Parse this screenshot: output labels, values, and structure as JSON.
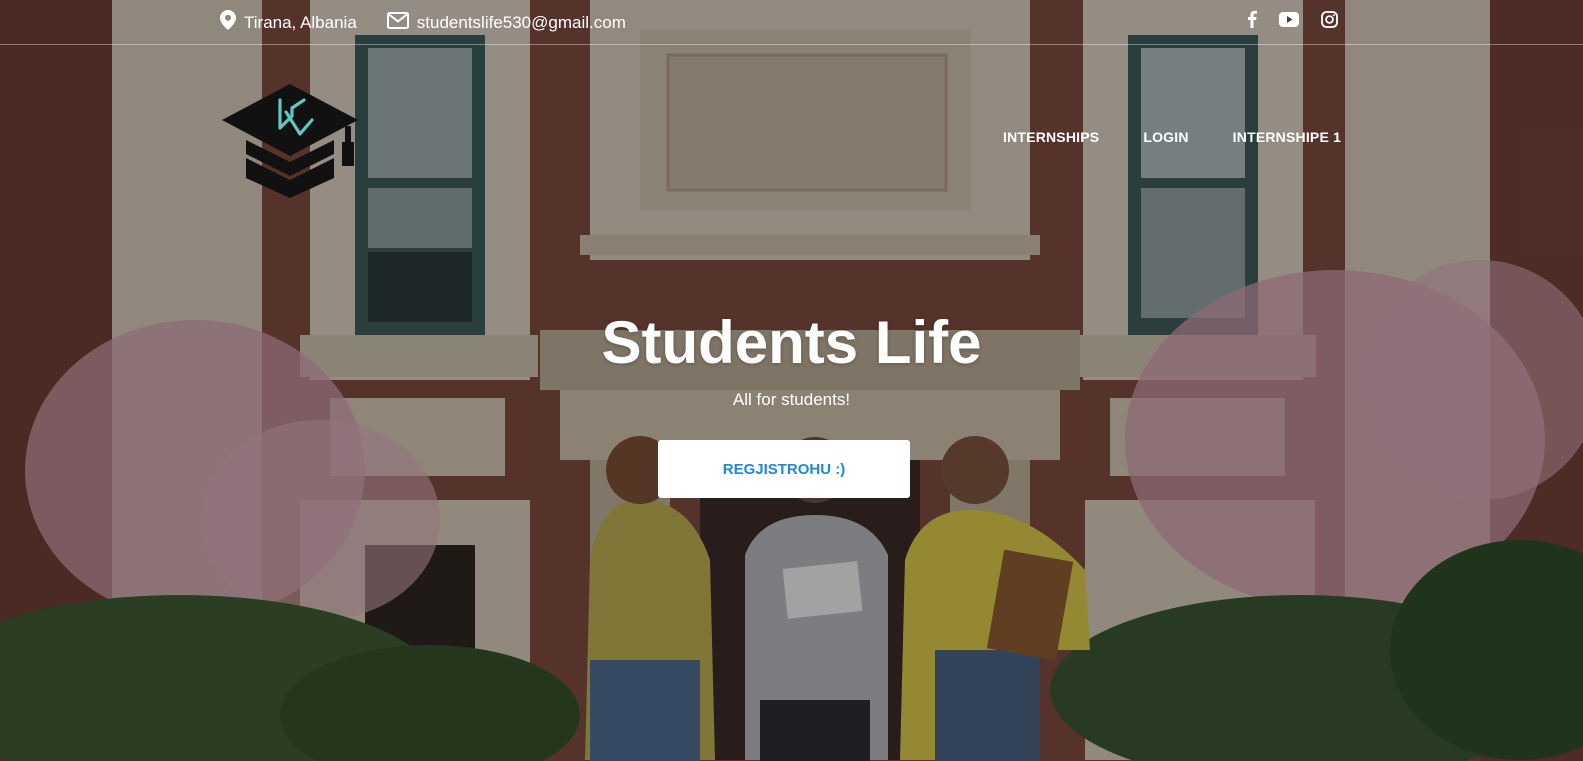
{
  "topbar": {
    "location": "Tirana, Albania",
    "email": "studentslife530@gmail.com",
    "location_icon": "map-pin-icon",
    "email_icon": "envelope-icon",
    "social": [
      "facebook-icon",
      "youtube-icon",
      "instagram-icon"
    ]
  },
  "logo": {
    "alt": "Students Life logo",
    "icon": "graduation-cap-logo"
  },
  "nav": {
    "items": [
      "INTERNSHIPS",
      "LOGIN",
      "INTERNSHIPE 1"
    ]
  },
  "hero": {
    "title": "Students Life",
    "subtitle": "All for students!",
    "cta_label": "REGJISTROHU :)"
  },
  "colors": {
    "accent": "#1e88d9",
    "logo_teal": "#5ec9c1",
    "overlay": "rgba(0,0,0,0.30)"
  }
}
